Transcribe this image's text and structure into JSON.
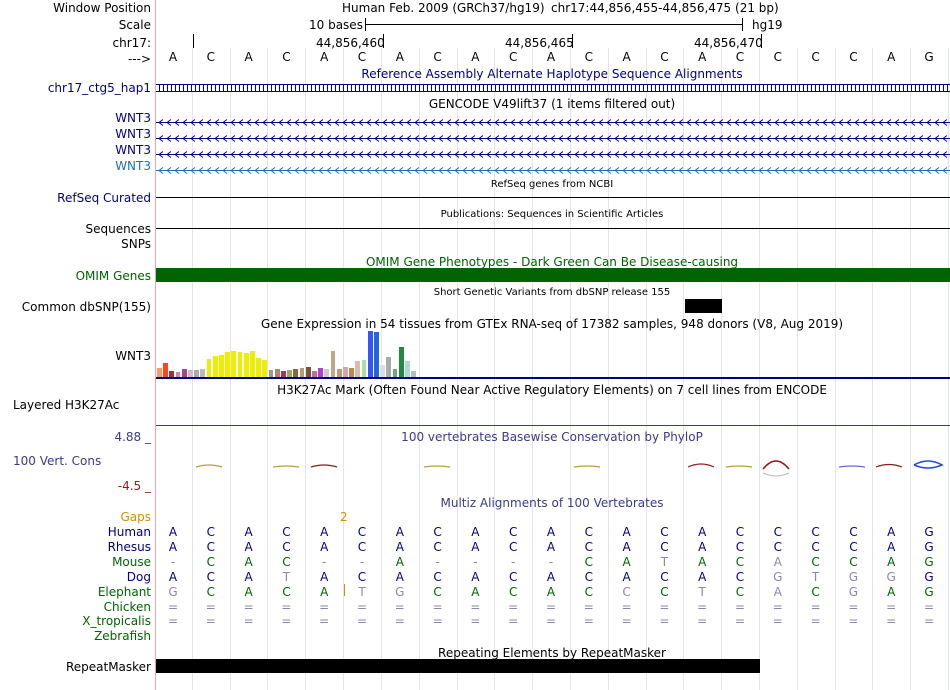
{
  "labels": {
    "window_position": "Window Position",
    "scale": "Scale",
    "chrom": "chr17:",
    "arrow": "--->",
    "alt_haplo": "chr17_ctg5_hap1",
    "refseq": "RefSeq Curated",
    "sequences": "Sequences",
    "snps": "SNPs",
    "omim": "OMIM Genes",
    "dbsnp": "Common dbSNP(155)",
    "gtex_gene": "WNT3",
    "h3k27ac": "Layered H3K27Ac",
    "cons_max": "4.88 _",
    "cons_name": "100 Vert. Cons",
    "cons_min": "-4.5 _"
  },
  "header": {
    "assembly": "Human Feb. 2009 (GRCh37/hg19)",
    "position": "chr17:44,856,455-44,856,475 (21 bp)",
    "scale_text": "10 bases",
    "scale_db": "hg19",
    "coord1": "44,856,460",
    "coord2": "44,856,465",
    "coord3": "44,856,470"
  },
  "ref_bases": [
    "A",
    "C",
    "A",
    "C",
    "A",
    "C",
    "A",
    "C",
    "A",
    "C",
    "A",
    "C",
    "A",
    "C",
    "A",
    "C",
    "C",
    "C",
    "C",
    "A",
    "G"
  ],
  "tracks": {
    "alt_haplo_title": "Reference Assembly Alternate Haplotype Sequence Alignments",
    "gencode_title": "GENCODE V49lift37 (1 items filtered out)",
    "gencode_items": [
      "WNT3",
      "WNT3",
      "WNT3",
      "WNT3"
    ],
    "refseq_title": "RefSeq genes from NCBI",
    "publications_title": "Publications: Sequences in Scientific Articles",
    "omim_title": "OMIM Gene Phenotypes - Dark Green Can Be Disease-causing",
    "dbsnp_title": "Short Genetic Variants from dbSNP release 155",
    "gtex_title": "Gene Expression in 54 tissues from GTEx RNA-seq of 17382 samples, 948 donors (V8, Aug 2019)",
    "h3k27ac_title": "H3K27Ac Mark (Often Found Near Active Regulatory Elements) on 7 cell lines from ENCODE",
    "cons_title": "100 vertebrates Basewise Conservation by PhyloP",
    "multiz_title": "Multiz Alignments of 100 Vertebrates",
    "gaps_label": "Gaps",
    "gaps_count": "2",
    "repeat_title": "Repeating Elements by RepeatMasker",
    "repeat_label": "RepeatMasker"
  },
  "species": [
    {
      "name": "Human",
      "color": "#000080",
      "bases": [
        "A",
        "C",
        "A",
        "C",
        "A",
        "C",
        "A",
        "C",
        "A",
        "C",
        "A",
        "C",
        "A",
        "C",
        "A",
        "C",
        "C",
        "C",
        "C",
        "A",
        "G"
      ]
    },
    {
      "name": "Rhesus",
      "color": "#000080",
      "bases": [
        "A",
        "C",
        "A",
        "C",
        "A",
        "C",
        "A",
        "C",
        "A",
        "C",
        "A",
        "C",
        "A",
        "C",
        "A",
        "C",
        "C",
        "C",
        "C",
        "A",
        "G"
      ]
    },
    {
      "name": "Mouse",
      "color": "#006400",
      "bases": [
        "-",
        "C",
        "A",
        "C",
        "-",
        "-",
        "A",
        "-",
        "-",
        "-",
        "-",
        "C",
        "A",
        "T",
        "A",
        "C",
        "A",
        "C",
        "C",
        "A",
        "G"
      ]
    },
    {
      "name": "Dog",
      "color": "#000080",
      "bases": [
        "A",
        "C",
        "A",
        "T",
        "A",
        "C",
        "A",
        "C",
        "A",
        "C",
        "A",
        "C",
        "A",
        "C",
        "A",
        "C",
        "G",
        "T",
        "G",
        "G",
        "G"
      ]
    },
    {
      "name": "Elephant",
      "color": "#006400",
      "bases": [
        "G",
        "C",
        "A",
        "C",
        "A",
        "T",
        "G",
        "C",
        "A",
        "C",
        "A",
        "C",
        "C",
        "C",
        "T",
        "C",
        "A",
        "C",
        "G",
        "A",
        "G"
      ]
    },
    {
      "name": "Chicken",
      "color": "#006400",
      "bases": [
        "=",
        "=",
        "=",
        "=",
        "=",
        "=",
        "=",
        "=",
        "=",
        "=",
        "=",
        "=",
        "=",
        "=",
        "=",
        "=",
        "=",
        "=",
        "=",
        "=",
        "="
      ]
    },
    {
      "name": "X_tropicalis",
      "color": "#006400",
      "bases": [
        "=",
        "=",
        "=",
        "=",
        "=",
        "=",
        "=",
        "=",
        "=",
        "=",
        "=",
        "=",
        "=",
        "=",
        "=",
        "=",
        "=",
        "=",
        "=",
        "=",
        "="
      ]
    },
    {
      "name": "Zebrafish",
      "color": "#006400",
      "bases": []
    }
  ],
  "gtex_values": [
    9,
    14,
    6,
    5,
    8,
    7,
    7,
    8,
    18,
    21,
    22,
    25,
    26,
    25,
    24,
    26,
    19,
    17,
    7,
    8,
    6,
    7,
    8,
    9,
    10,
    6,
    9,
    8,
    26,
    8,
    10,
    9,
    16,
    17,
    46,
    45,
    12,
    20,
    8,
    30,
    16,
    6
  ],
  "gtex_colors": [
    "#ff9966",
    "#ff4422",
    "#993344",
    "#cc88aa",
    "#aa4488",
    "#ccbbcc",
    "#aaaaaa",
    "#bbbbbb",
    "#eeee00",
    "#eeee00",
    "#eeee00",
    "#eeee00",
    "#eeee00",
    "#eeee00",
    "#eeee00",
    "#eeee00",
    "#eeee00",
    "#eeee00",
    "#999999",
    "#aa8866",
    "#aa3366",
    "#99aa66",
    "#886644",
    "#bb9977",
    "#775533",
    "#cc66aa",
    "#aa44cc",
    "#cccccc",
    "#bbaa88",
    "#bb9977",
    "#ccaaaa",
    "#bb8855",
    "#ddbbaa",
    "#aaddaa",
    "#3355ff",
    "#2266dd",
    "#dddddd",
    "#aaaaaa",
    "#66aa88",
    "#228844",
    "#aaddcc",
    "#bbbbbb"
  ],
  "colors": {
    "navy": "#000080",
    "omim_green": "#006400",
    "blue_gene": "#1e6fb0",
    "gaps_orange": "#e08a00",
    "cons_blue": "#3a3a8c",
    "cons_red": "#8c1b1b"
  }
}
